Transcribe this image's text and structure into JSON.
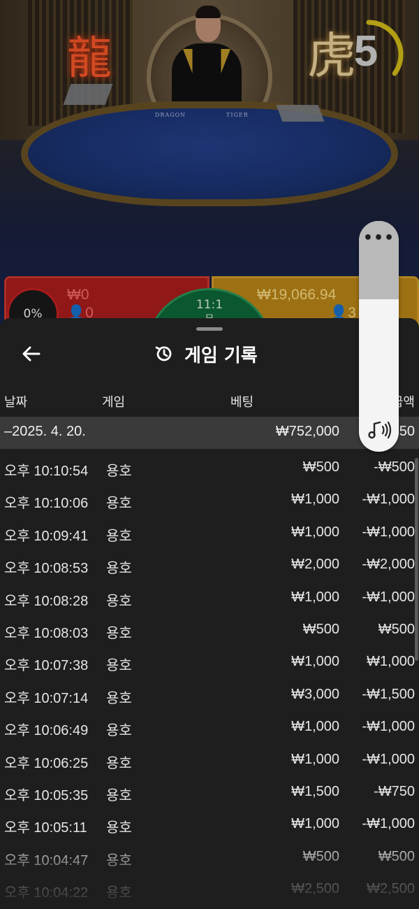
{
  "video": {
    "table_labels": {
      "dragon": "DRAGON",
      "tiger": "TIGER"
    },
    "timer": {
      "value": "5",
      "progress": 0.35,
      "ring_color": "#d9c21a"
    }
  },
  "bets": {
    "dragon": {
      "percent": "0%",
      "amount": "₩0",
      "players": "0",
      "color": "#b01e1e"
    },
    "tie": {
      "ratio": "11:1",
      "label": "무"
    },
    "tiger": {
      "amount": "₩19,066.94",
      "players": "3",
      "color": "#c08a18"
    }
  },
  "history": {
    "title": "게임 기록",
    "columns": {
      "date": "날짜",
      "game": "게임",
      "bet": "베팅",
      "payout": "지급액"
    },
    "summary": {
      "date": "–2025. 4. 20.",
      "bet": "₩752,000",
      "payout": "-₩1,750"
    },
    "rows": [
      {
        "time": "오후 10:10:54",
        "game": "용호",
        "bet": "₩500",
        "payout": "-₩500"
      },
      {
        "time": "오후 10:10:06",
        "game": "용호",
        "bet": "₩1,000",
        "payout": "-₩1,000"
      },
      {
        "time": "오후 10:09:41",
        "game": "용호",
        "bet": "₩1,000",
        "payout": "-₩1,000"
      },
      {
        "time": "오후 10:08:53",
        "game": "용호",
        "bet": "₩2,000",
        "payout": "-₩2,000"
      },
      {
        "time": "오후 10:08:28",
        "game": "용호",
        "bet": "₩1,000",
        "payout": "-₩1,000"
      },
      {
        "time": "오후 10:08:03",
        "game": "용호",
        "bet": "₩500",
        "payout": "₩500"
      },
      {
        "time": "오후 10:07:38",
        "game": "용호",
        "bet": "₩1,000",
        "payout": "₩1,000"
      },
      {
        "time": "오후 10:07:14",
        "game": "용호",
        "bet": "₩3,000",
        "payout": "-₩1,500"
      },
      {
        "time": "오후 10:06:49",
        "game": "용호",
        "bet": "₩1,000",
        "payout": "-₩1,000"
      },
      {
        "time": "오후 10:06:25",
        "game": "용호",
        "bet": "₩1,000",
        "payout": "-₩1,000"
      },
      {
        "time": "오후 10:05:35",
        "game": "용호",
        "bet": "₩1,500",
        "payout": "-₩750"
      },
      {
        "time": "오후 10:05:11",
        "game": "용호",
        "bet": "₩1,000",
        "payout": "-₩1,000"
      },
      {
        "time": "오후 10:04:47",
        "game": "용호",
        "bet": "₩500",
        "payout": "₩500"
      },
      {
        "time": "오후 10:04:22",
        "game": "용호",
        "bet": "₩2,500",
        "payout": "₩2,500"
      }
    ]
  },
  "side_controls": {
    "menu_icon": "more-dots-icon",
    "volume_icon": "music-volume-icon",
    "volume_level": 0.66
  }
}
